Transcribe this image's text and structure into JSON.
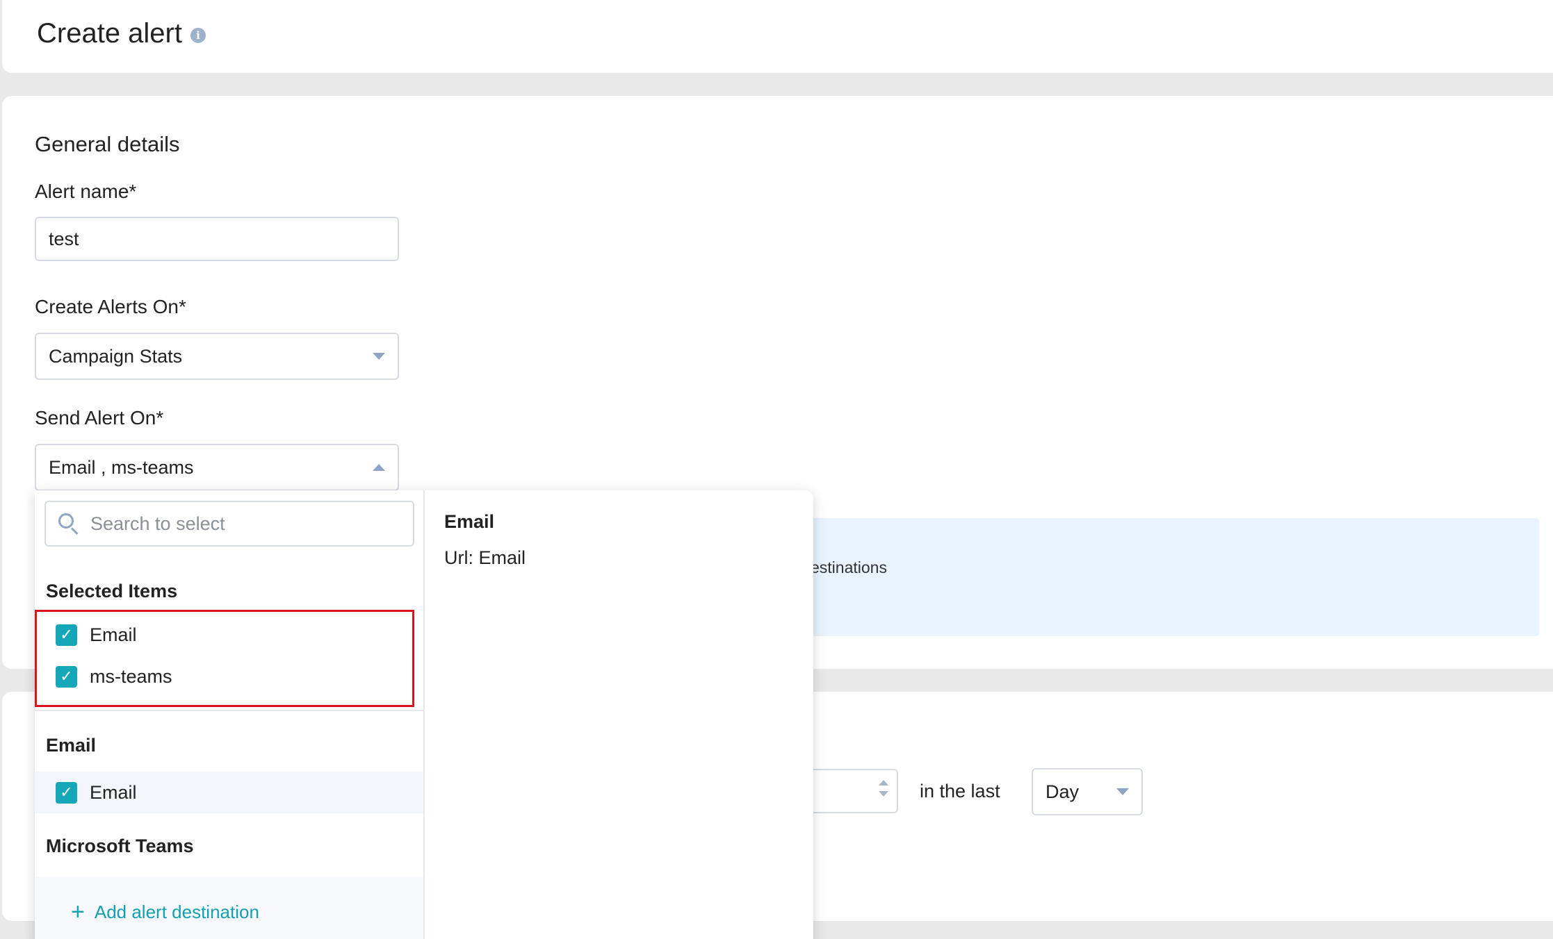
{
  "header": {
    "title": "Create alert",
    "info_icon": "info-icon"
  },
  "general": {
    "section_title": "General details",
    "alert_name": {
      "label": "Alert name*",
      "value": "test"
    },
    "create_alerts_on": {
      "label": "Create Alerts On*",
      "value": "Campaign Stats"
    },
    "send_alert_on": {
      "label": "Send Alert On*",
      "value": "Email , ms-teams"
    }
  },
  "info_panel": {
    "text_fragment": "estinations"
  },
  "condition": {
    "in_the_last": "in the last",
    "period": "Day"
  },
  "dropdown": {
    "search_placeholder": "Search to select",
    "selected_title": "Selected Items",
    "selected": [
      {
        "label": "Email",
        "checked": true
      },
      {
        "label": "ms-teams",
        "checked": true
      }
    ],
    "groups": [
      {
        "title": "Email",
        "items": [
          {
            "label": "Email",
            "checked": true
          }
        ]
      },
      {
        "title": "Microsoft Teams",
        "items": []
      }
    ],
    "add_destination": "Add alert destination",
    "detail": {
      "title": "Email",
      "url": "Url: Email"
    }
  },
  "colors": {
    "accent": "#15a6b8",
    "highlight_border": "#d9141c",
    "info_bg": "#e9f3fd"
  }
}
